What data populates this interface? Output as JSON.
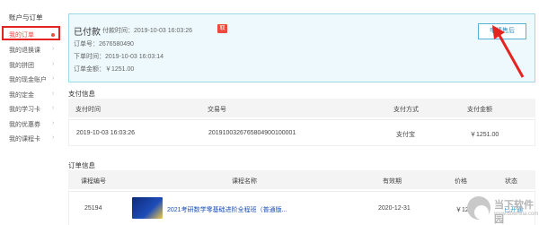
{
  "sidebar": {
    "header": "账户与订单",
    "items": [
      {
        "label": "我的订单",
        "active": true
      },
      {
        "label": "我的退换课",
        "active": false
      },
      {
        "label": "我的拼团",
        "active": false
      },
      {
        "label": "我的现金账户",
        "active": false
      },
      {
        "label": "我的定金",
        "active": false
      },
      {
        "label": "我的学习卡",
        "active": false
      },
      {
        "label": "我的优惠券",
        "active": false
      },
      {
        "label": "我的课程卡",
        "active": false
      }
    ]
  },
  "order": {
    "status": "已付款",
    "pay_time": "付款时间：2019-10-03 16:03:26",
    "badge": "取",
    "order_no": "订单号：2676580490",
    "order_time": "下单时间：2019-10-03 16:03:14",
    "amount": "订单金额：￥1251.00",
    "apply_button": "申请售后"
  },
  "payment": {
    "title": "支付信息",
    "headers": [
      "支付时间",
      "交易号",
      "支付方式",
      "支付金额"
    ],
    "row": [
      "2019-10-03 16:03:26",
      "2019100326765804900100001",
      "支付宝",
      "￥1251.00"
    ]
  },
  "order_info": {
    "title": "订单信息",
    "headers": [
      "课程编号",
      "课程名称",
      "有效期",
      "价格",
      "状态"
    ],
    "row": {
      "course_id": "25194",
      "course_name": "2021考研数学零基础进阶全程班（普通版...",
      "expiry": "2020-12-31",
      "price": "￥1251.00",
      "status": "已开通"
    }
  },
  "watermark": {
    "line1": "当下软件园",
    "line2": "www.downxia.com"
  },
  "colors": {
    "accent": "#e84c3d",
    "highlight": "#e52420",
    "card_border": "#9fd8ea",
    "card_bg": "#eef9fd",
    "link": "#1a4fb5"
  }
}
